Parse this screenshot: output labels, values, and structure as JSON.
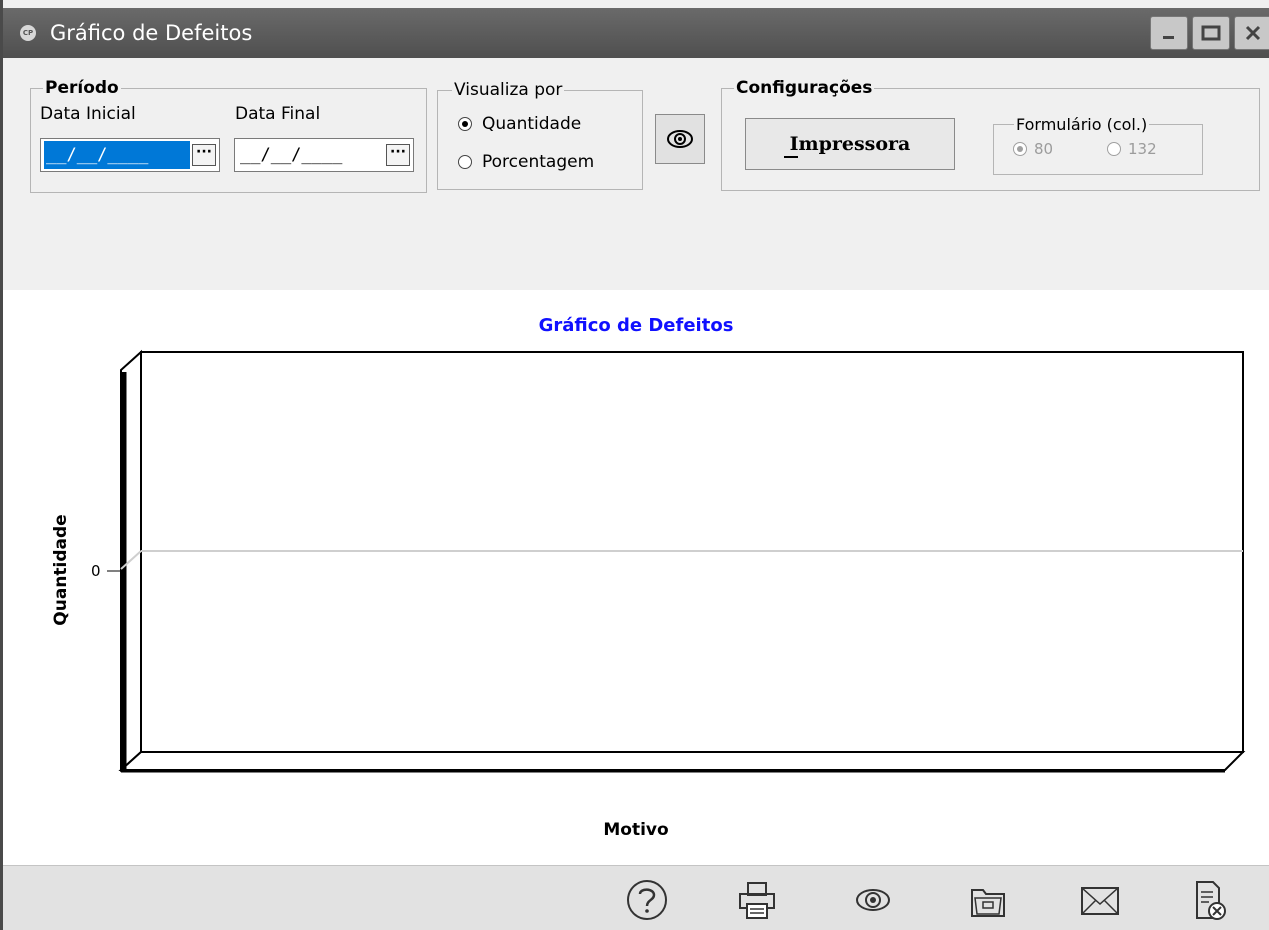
{
  "window": {
    "title": "Gráfico de Defeitos",
    "app_icon": "CP"
  },
  "periodo": {
    "legend": "Período",
    "data_inicial_label": "Data Inicial",
    "data_inicial_value": "__/__/____",
    "data_final_label": "Data Final",
    "data_final_value": "__/__/____"
  },
  "visualiza": {
    "legend": "Visualiza por",
    "option_quantidade": "Quantidade",
    "option_porcentagem": "Porcentagem",
    "selected": "Quantidade"
  },
  "config": {
    "legend": "Configurações",
    "print_button": "Impressora",
    "form_legend": "Formulário (col.)",
    "option_80": "80",
    "option_132": "132",
    "selected": "80"
  },
  "chart_data": {
    "type": "bar",
    "title": "Gráfico de Defeitos",
    "xlabel": "Motivo",
    "ylabel": "Quantidade",
    "y_ticks": [
      "0"
    ],
    "categories": [],
    "values": [],
    "grid": true
  },
  "icons": {
    "help": "help-icon",
    "print": "printer-icon",
    "view": "eye-icon",
    "folder": "folder-icon",
    "mail": "mail-icon",
    "close_doc": "close-document-icon"
  }
}
